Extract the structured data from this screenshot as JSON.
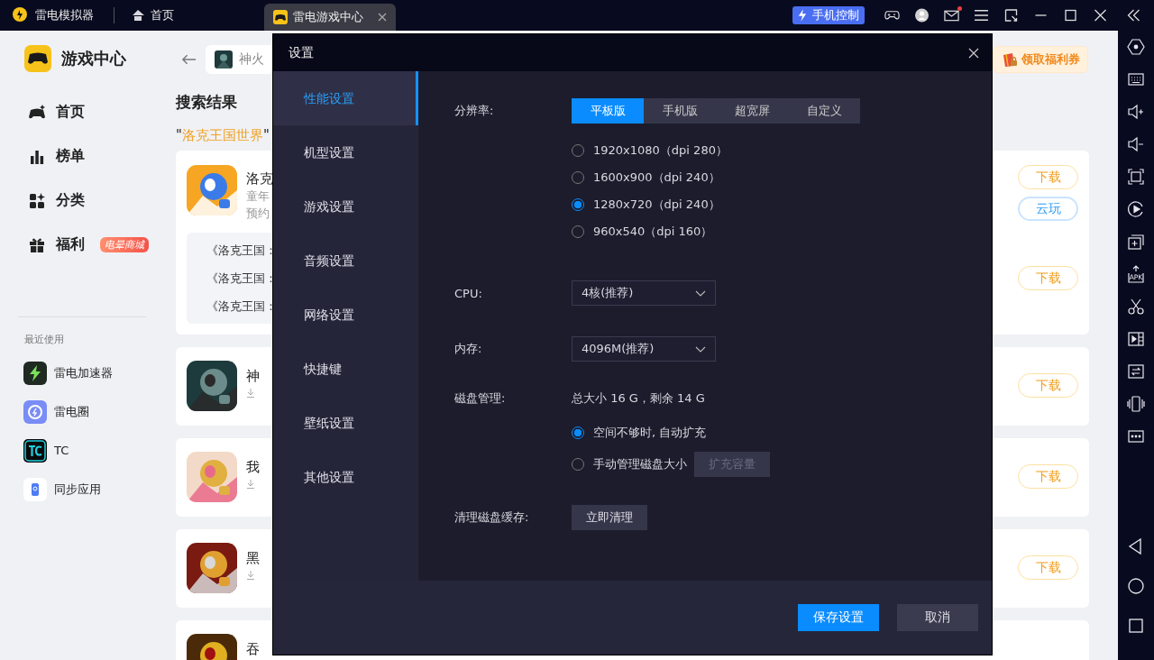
{
  "titlebar": {
    "app_name": "雷电模拟器",
    "tabs": [
      {
        "label": "首页",
        "kind": "home",
        "selected": false
      },
      {
        "label": "雷电游戏中心",
        "kind": "app",
        "selected": true
      }
    ],
    "phone_control": "手机控制",
    "mail_unread": true
  },
  "sidebar": {
    "title": "游戏中心",
    "nav": [
      {
        "label": "首页"
      },
      {
        "label": "榜单"
      },
      {
        "label": "分类"
      },
      {
        "label": "福利",
        "badge": "电晕商城"
      }
    ],
    "recent_heading": "最近使用",
    "recent": [
      {
        "label": "雷电加速器"
      },
      {
        "label": "雷电圈"
      },
      {
        "label": "TC"
      },
      {
        "label": "同步应用"
      }
    ]
  },
  "content": {
    "search_value": "神火",
    "coupon": "领取福利券",
    "heading": "搜索结果",
    "query_parts": [
      {
        "text": "\"",
        "kind": "plain"
      },
      {
        "text": "洛克王国世界",
        "kind": "keyword"
      },
      {
        "text": "\"",
        "kind": "plain"
      }
    ],
    "cards": [
      {
        "title": "洛克",
        "lines": [
          "童年",
          "预约"
        ],
        "sublist": [
          "《洛克王国：",
          "《洛克王国：",
          "《洛克王国："
        ],
        "buttons": [
          {
            "label": "下载",
            "kind": "download"
          },
          {
            "label": "云玩",
            "kind": "cloud"
          }
        ],
        "sub_button": {
          "label": "下载",
          "kind": "download"
        }
      },
      {
        "title": "神",
        "download_mark": true,
        "buttons": [
          {
            "label": "下载",
            "kind": "download"
          }
        ]
      },
      {
        "title": "我",
        "download_mark": true,
        "buttons": [
          {
            "label": "下载",
            "kind": "download"
          }
        ]
      },
      {
        "title": "黑",
        "download_mark": true,
        "buttons": [
          {
            "label": "下载",
            "kind": "download"
          }
        ]
      },
      {
        "title": "吞"
      }
    ]
  },
  "toolbar": {
    "apk_label": "APK"
  },
  "dialog": {
    "title": "设置",
    "nav": [
      {
        "label": "性能设置",
        "selected": true
      },
      {
        "label": "机型设置",
        "selected": false
      },
      {
        "label": "游戏设置",
        "selected": false
      },
      {
        "label": "音频设置",
        "selected": false
      },
      {
        "label": "网络设置",
        "selected": false
      },
      {
        "label": "快捷键",
        "selected": false
      },
      {
        "label": "壁纸设置",
        "selected": false
      },
      {
        "label": "其他设置",
        "selected": false
      }
    ],
    "resolution": {
      "label": "分辨率:",
      "modes": [
        {
          "label": "平板版",
          "selected": true
        },
        {
          "label": "手机版",
          "selected": false
        },
        {
          "label": "超宽屏",
          "selected": false
        },
        {
          "label": "自定义",
          "selected": false
        }
      ],
      "options": [
        {
          "label": "1920x1080（dpi 280）",
          "selected": false
        },
        {
          "label": "1600x900（dpi 240）",
          "selected": false
        },
        {
          "label": "1280x720（dpi 240）",
          "selected": true
        },
        {
          "label": "960x540（dpi 160）",
          "selected": false
        }
      ]
    },
    "cpu": {
      "label": "CPU:",
      "value": "4核(推荐)"
    },
    "memory": {
      "label": "内存:",
      "value": "4096M(推荐)"
    },
    "disk": {
      "label": "磁盘管理:",
      "info": "总大小 16 G，剩余 14 G",
      "options": [
        {
          "label": "空间不够时, 自动扩充",
          "selected": true
        },
        {
          "label": "手动管理磁盘大小",
          "selected": false
        }
      ],
      "expand_button": {
        "label": "扩充容量",
        "disabled": true
      }
    },
    "cache": {
      "label": "清理磁盘缓存:",
      "button": "立即清理"
    },
    "save": "保存设置",
    "cancel": "取消"
  }
}
